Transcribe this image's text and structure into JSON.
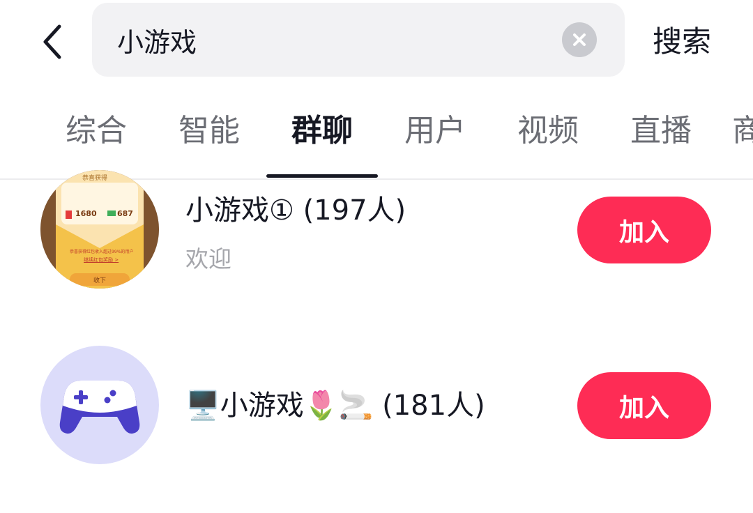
{
  "search": {
    "query": "小游戏",
    "submit_label": "搜索"
  },
  "tabs": [
    {
      "label": "综合",
      "active": false
    },
    {
      "label": "智能",
      "active": false
    },
    {
      "label": "群聊",
      "active": true
    },
    {
      "label": "用户",
      "active": false
    },
    {
      "label": "视频",
      "active": false
    },
    {
      "label": "直播",
      "active": false
    },
    {
      "label": "商",
      "active": false
    }
  ],
  "groups": [
    {
      "name": "小游戏① (197人)",
      "subtitle": "欢迎",
      "join_label": "加入",
      "avatar": {
        "header": "恭喜获得",
        "amount_red": "1680",
        "amount_green": "687",
        "line1": "恭喜获得红包收入超过99%的用户",
        "line2": "继续红包奖励 >",
        "button": "收下"
      }
    },
    {
      "name": "🖥️小游戏🌷🚬 (181人)",
      "subtitle": "",
      "join_label": "加入",
      "avatar": {
        "icon": "gamepad-icon"
      }
    }
  ],
  "colors": {
    "accent": "#fe2c55",
    "search_bg": "#f2f2f4",
    "avatar2_bg": "#dcdcfa",
    "gamepad": "#4a3fc7"
  }
}
